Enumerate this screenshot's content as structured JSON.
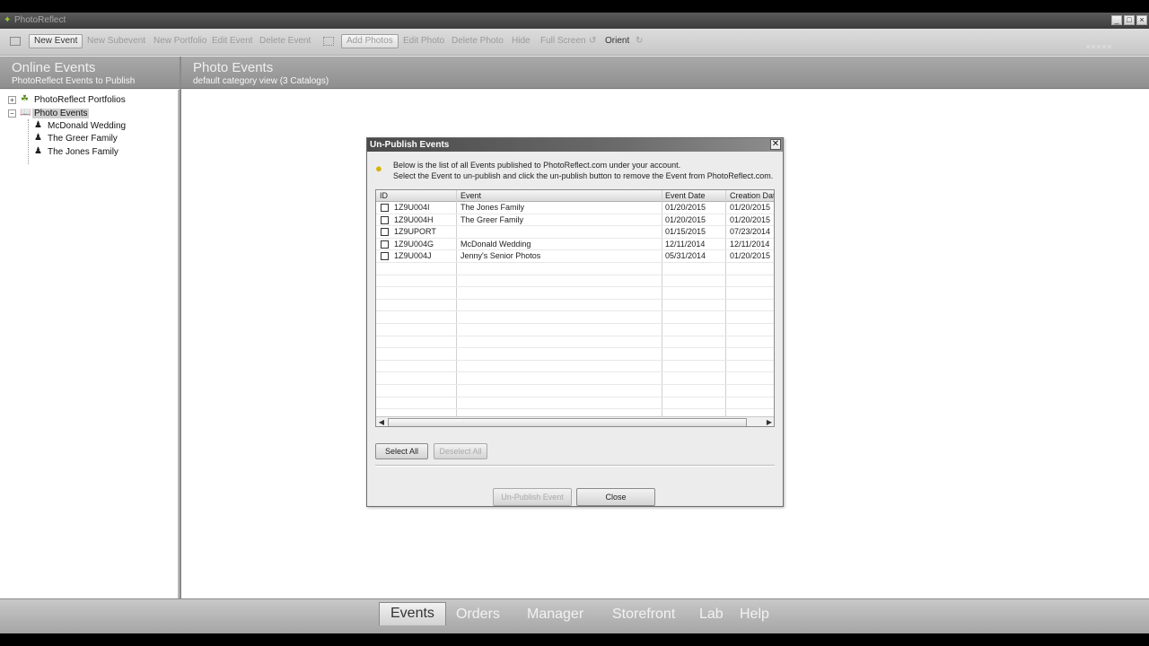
{
  "window": {
    "title": "PhotoReflect",
    "buttons": [
      "_",
      "□",
      "×"
    ]
  },
  "toolbar": {
    "new_event": "New Event",
    "new_subevent": "New Subevent",
    "new_portfolio": "New Portfolio",
    "edit_event": "Edit Event",
    "delete_event": "Delete Event",
    "add_photos": "Add Photos",
    "edit_photo": "Edit Photo",
    "delete_photo": "Delete Photo",
    "hide": "Hide",
    "full_screen": "Full Screen",
    "orient": "Orient"
  },
  "left_header": {
    "title": "Online Events",
    "subtitle": "PhotoReflect Events to Publish"
  },
  "main_header": {
    "title": "Photo Events",
    "subtitle": "default category view (3 Catalogs)"
  },
  "tree": {
    "portfolios": "PhotoReflect Portfolios",
    "photo_events": "Photo Events",
    "children": [
      "McDonald Wedding",
      "The Greer Family",
      "The Jones Family"
    ]
  },
  "dialog": {
    "title": "Un-Publish Events",
    "info_line1": "Below is the list of all Events published to PhotoReflect.com under your account.",
    "info_line2": "Select the Event to un-publish and click the un-publish button to remove the Event from PhotoReflect.com.",
    "columns": [
      "ID",
      "Event",
      "Event Date",
      "Creation Date"
    ],
    "rows": [
      {
        "id": "1Z9U004I",
        "event": "The Jones Family",
        "event_date": "01/20/2015",
        "creation_date": "01/20/2015"
      },
      {
        "id": "1Z9U004H",
        "event": "The Greer Family",
        "event_date": "01/20/2015",
        "creation_date": "01/20/2015"
      },
      {
        "id": "1Z9UPORT",
        "event": "",
        "event_date": "01/15/2015",
        "creation_date": "07/23/2014"
      },
      {
        "id": "1Z9U004G",
        "event": "McDonald Wedding",
        "event_date": "12/11/2014",
        "creation_date": "12/11/2014"
      },
      {
        "id": "1Z9U004J",
        "event": "Jenny's Senior Photos",
        "event_date": "05/31/2014",
        "creation_date": "01/20/2015"
      }
    ],
    "select_all": "Select All",
    "deselect_all": "Deselect All",
    "unpublish": "Un-Publish Event",
    "close": "Close"
  },
  "bottom_nav": [
    "Events",
    "Orders",
    "Manager",
    "Storefront",
    "Lab",
    "Help"
  ]
}
